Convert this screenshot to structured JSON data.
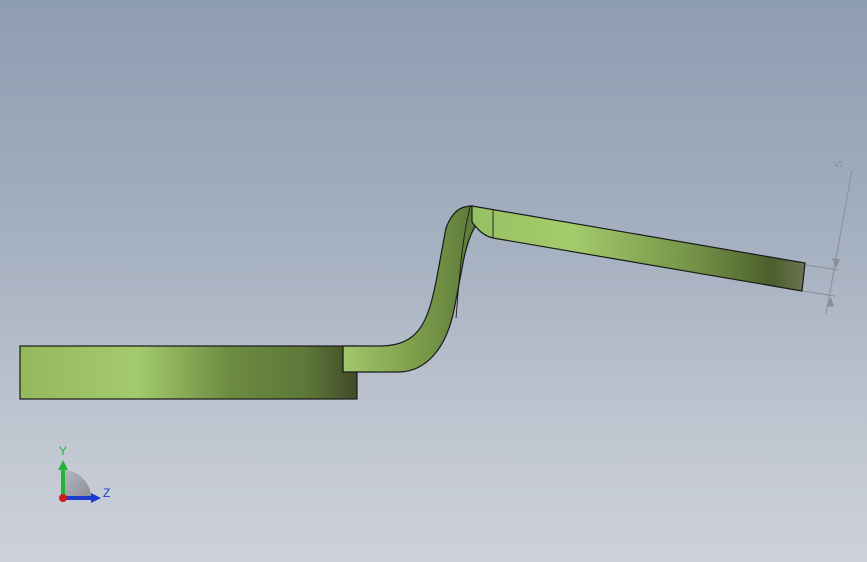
{
  "viewport": {
    "background_top": "#8e9db1",
    "background_bottom": "#cdd2da"
  },
  "model": {
    "part_color_light": "#a1c96b",
    "part_color_dark": "#556a35",
    "edge_color": "#1a1a1a"
  },
  "dimension": {
    "value": "5",
    "color": "#8a8f97"
  },
  "triad": {
    "y_label": "Y",
    "z_label": "Z",
    "y_color": "#22b33a",
    "z_color": "#1d3ccf",
    "x_color": "#d11a1a"
  }
}
